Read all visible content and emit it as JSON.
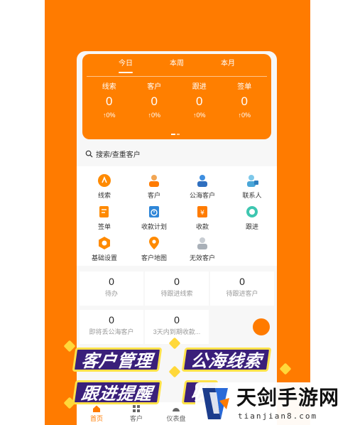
{
  "period_tabs": [
    "今日",
    "本周",
    "本月"
  ],
  "metrics": [
    {
      "label": "线索",
      "value": "0",
      "delta": "↑0%"
    },
    {
      "label": "客户",
      "value": "0",
      "delta": "↑0%"
    },
    {
      "label": "跟进",
      "value": "0",
      "delta": "↑0%"
    },
    {
      "label": "签单",
      "value": "0",
      "delta": "↑0%"
    }
  ],
  "search": {
    "label": "搜索/查重客户"
  },
  "grid": [
    {
      "label": "线索",
      "icon": "clue-icon"
    },
    {
      "label": "客户",
      "icon": "customer-icon"
    },
    {
      "label": "公海客户",
      "icon": "public-customer-icon"
    },
    {
      "label": "联系人",
      "icon": "contact-icon"
    },
    {
      "label": "签单",
      "icon": "contract-icon"
    },
    {
      "label": "收款计划",
      "icon": "payment-plan-icon"
    },
    {
      "label": "收款",
      "icon": "payment-icon"
    },
    {
      "label": "跟进",
      "icon": "follow-up-icon"
    },
    {
      "label": "基础设置",
      "icon": "settings-icon"
    },
    {
      "label": "客户地图",
      "icon": "map-pin-icon"
    },
    {
      "label": "无效客户",
      "icon": "invalid-customer-icon"
    }
  ],
  "counts": [
    {
      "value": "0",
      "label": "待办"
    },
    {
      "value": "0",
      "label": "待跟进线索"
    },
    {
      "value": "0",
      "label": "待跟进客户"
    },
    {
      "value": "0",
      "label": "即将丢公海客户"
    },
    {
      "value": "0",
      "label": "3天内到期收款..."
    }
  ],
  "banner": {
    "words": [
      "客户管理",
      "公海线索",
      "跟进提醒",
      "收"
    ]
  },
  "bottom_nav": [
    {
      "label": "首页",
      "icon": "home-icon",
      "active": true
    },
    {
      "label": "客户",
      "icon": "grid-icon",
      "active": false
    },
    {
      "label": "仪表盘",
      "icon": "dashboard-icon",
      "active": false
    }
  ],
  "watermark": {
    "name": "天剑手游网",
    "url": "tianjian8.com"
  },
  "colors": {
    "primary": "#ff7b00",
    "banner_bg": "#3a1f7a",
    "banner_border": "#ffe24a"
  }
}
